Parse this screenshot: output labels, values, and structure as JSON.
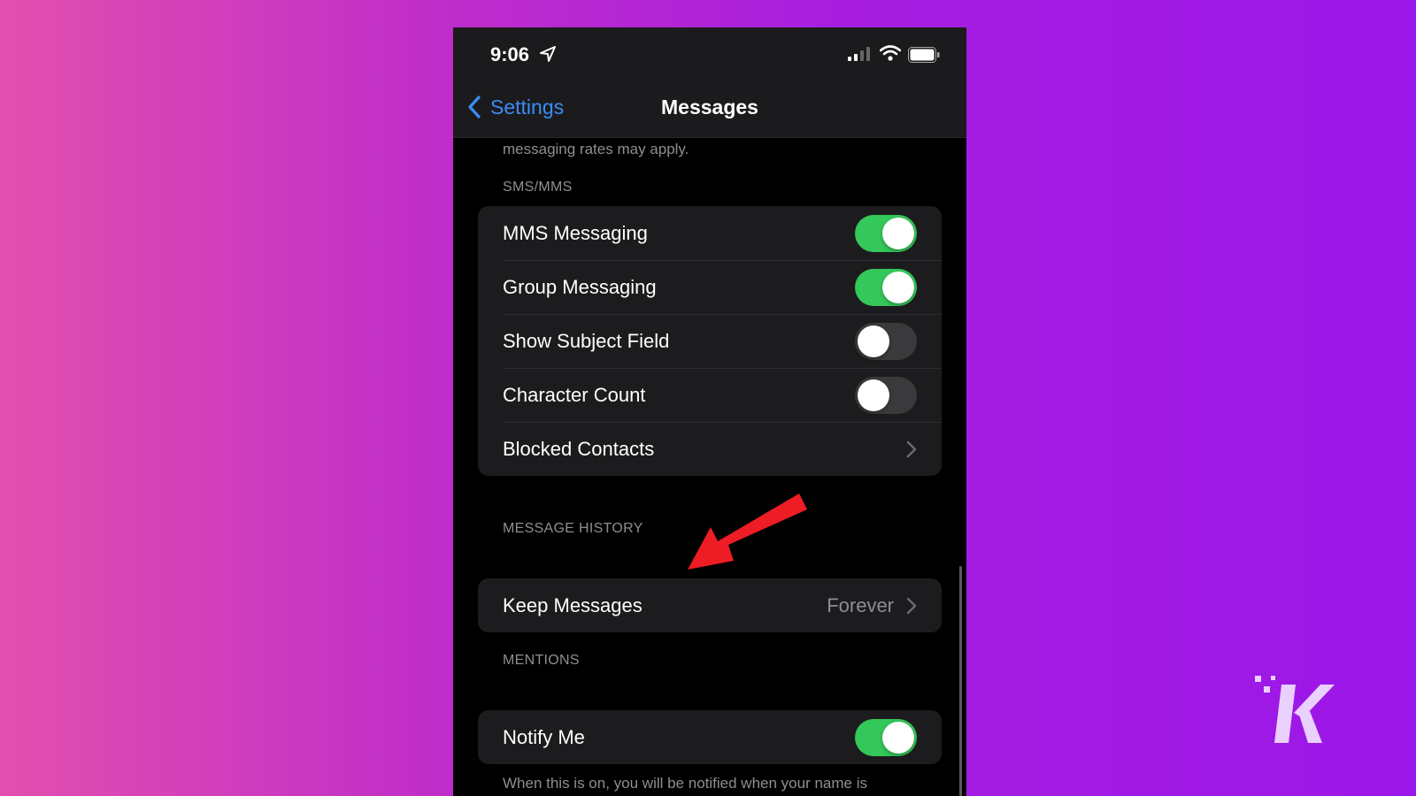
{
  "status_bar": {
    "time": "9:06",
    "icons": [
      "location-arrow-icon",
      "cellular-signal-icon",
      "wifi-icon",
      "battery-icon"
    ]
  },
  "nav": {
    "back_label": "Settings",
    "title": "Messages"
  },
  "top_note": "messaging rates may apply.",
  "sections": {
    "sms_mms": {
      "header": "SMS/MMS",
      "rows": [
        {
          "label": "MMS Messaging",
          "toggle": true
        },
        {
          "label": "Group Messaging",
          "toggle": true
        },
        {
          "label": "Show Subject Field",
          "toggle": false
        },
        {
          "label": "Character Count",
          "toggle": false
        },
        {
          "label": "Blocked Contacts",
          "chevron": true
        }
      ]
    },
    "message_history": {
      "header": "MESSAGE HISTORY",
      "rows": [
        {
          "label": "Keep Messages",
          "value": "Forever",
          "chevron": true
        }
      ]
    },
    "mentions": {
      "header": "MENTIONS",
      "rows": [
        {
          "label": "Notify Me",
          "toggle": true
        }
      ],
      "footer": "When this is on, you will be notified when your name is mentioned even if conversations are muted."
    }
  },
  "colors": {
    "accent_blue": "#3b8cf7",
    "toggle_on": "#34c759",
    "annotation_arrow": "#ee1c25"
  }
}
